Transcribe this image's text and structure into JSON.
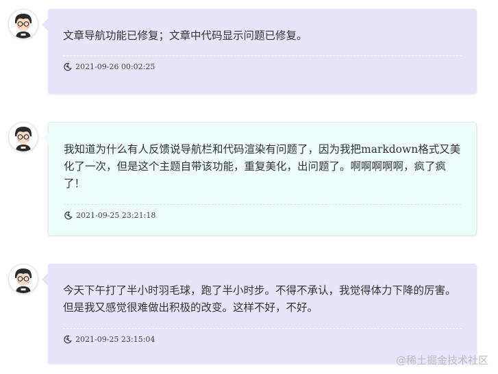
{
  "posts": [
    {
      "text": "文章导航功能已修复；文章中代码显示问题已修复。",
      "timestamp": "2021-09-26 00:02:25",
      "bubble_color": "#e8e5fb",
      "time_icon": "moon-icon"
    },
    {
      "text": "我知道为什么有人反馈说导航栏和代码渲染有问题了，因为我把markdown格式又美化了一次，但是这个主题自带该功能，重复美化，出问题了。啊啊啊啊啊，疯了疯了！",
      "timestamp": "2021-09-25 23:21:18",
      "bubble_color": "#edfefb",
      "time_icon": "moon-icon"
    },
    {
      "text": "今天下午打了半小时羽毛球，跑了半小时步。不得不承认，我觉得体力下降的厉害。但是我又感觉很难做出积极的改变。这样不好，不好。",
      "timestamp": "2021-09-25 23:15:04",
      "bubble_color": "#e8e5fb",
      "time_icon": "moon-icon"
    }
  ],
  "watermark": "@稀土掘金技术社区"
}
